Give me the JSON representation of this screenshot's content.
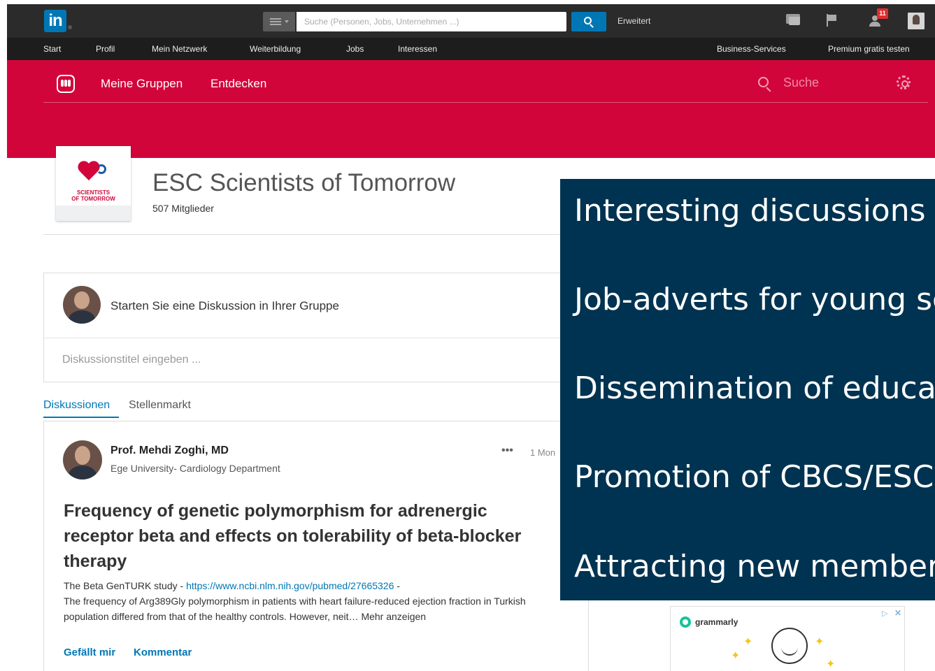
{
  "topbar": {
    "logo": "in",
    "search_placeholder": "Suche (Personen, Jobs, Unternehmen ...)",
    "advanced_label": "Erweitert",
    "notification_count": "11"
  },
  "nav": {
    "items": [
      "Start",
      "Profil",
      "Mein Netzwerk",
      "Weiterbildung",
      "Jobs",
      "Interessen"
    ],
    "business": "Business-Services",
    "premium": "Premium gratis testen"
  },
  "groups_header": {
    "my_groups": "Meine Gruppen",
    "discover": "Entdecken",
    "search_placeholder": "Suche"
  },
  "group": {
    "logo_text_1": "SCIENTISTS",
    "logo_text_2": "OF TOMORROW",
    "title": "ESC Scientists of Tomorrow",
    "members": "507 Mitglieder"
  },
  "start_discussion": {
    "prompt": "Starten Sie eine Diskussion in Ihrer Gruppe",
    "title_placeholder": "Diskussionstitel eingeben ..."
  },
  "tabs": [
    "Diskussionen",
    "Stellenmarkt"
  ],
  "post": {
    "author": "Prof. Mehdi Zoghi, MD",
    "affiliation": "Ege University- Cardiology Department",
    "more": "•••",
    "time": "1 Mon",
    "title": "Frequency of genetic polymorphism for adrenergic receptor beta and effects on tolerability of beta-blocker therapy",
    "body_prefix": "The Beta GenTURK study - ",
    "link": "https://www.ncbi.nlm.nih.gov/pubmed/27665326",
    "body_suffix": " -",
    "body_text": "The frequency of Arg389Gly polymorphism in patients with heart failure-reduced ejection fraction in Turkish population differed from that of the healthy controls. However, neit… ",
    "more_link": "Mehr anzeigen",
    "like": "Gefällt mir",
    "comment": "Kommentar"
  },
  "ad": {
    "brand": "grammarly"
  },
  "overlay": {
    "items": [
      "Interesting discussions",
      "Job-adverts for young sc",
      "Dissemination of educat",
      "Promotion of CBCS/ESC",
      "Attracting new member"
    ],
    "background": "#003351"
  },
  "colors": {
    "linkedin_blue": "#0077b5",
    "groups_red": "#d2053b",
    "topbar": "#2b2b2b"
  }
}
